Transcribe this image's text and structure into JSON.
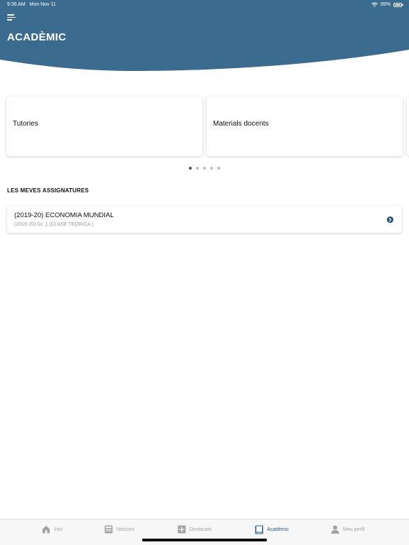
{
  "status_bar": {
    "time": "9:36 AM",
    "date": "Mon Nov 11",
    "battery": "89%"
  },
  "header": {
    "title": "ACADÈMIC",
    "color": "#3b6c8f"
  },
  "carousel": {
    "cards": [
      {
        "label": "Tutories"
      },
      {
        "label": "Materials docents"
      }
    ],
    "active_page": 1,
    "page_count": 5
  },
  "subjects": {
    "title": "LES MEVES ASSIGNATURES",
    "items": [
      {
        "name": "(2019-20) ECONOMIA MUNDIAL",
        "detail": "(2019-20) Gr. 1 (CLASE TEÓRICA )"
      }
    ]
  },
  "tabbar": {
    "tabs": [
      {
        "label": "Inici",
        "icon": "home-icon"
      },
      {
        "label": "Notícies",
        "icon": "news-icon"
      },
      {
        "label": "Destacats",
        "icon": "plus-square-icon"
      },
      {
        "label": "Acadèmic",
        "icon": "book-icon",
        "active": true
      },
      {
        "label": "Meu perfil",
        "icon": "user-icon"
      }
    ],
    "active_color": "#2a5d88",
    "inactive_color": "#a3a3a3"
  }
}
